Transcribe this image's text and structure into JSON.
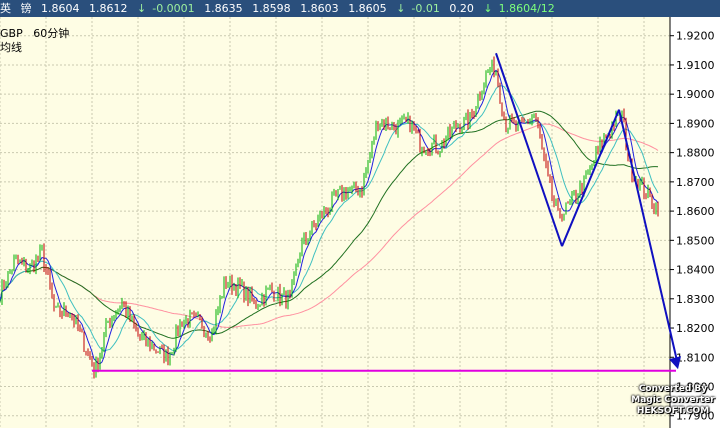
{
  "header": {
    "symbol_cn": "英",
    "symbol_cn2": "镑",
    "values": [
      "1.8604",
      "1.8612"
    ],
    "change_arrow": "↓",
    "change": "-0.0001",
    "ohlc": [
      "1.8635",
      "1.8598",
      "1.8603",
      "1.8605"
    ],
    "pct_arrow": "↓",
    "pct": "-0.01",
    "vol": "0.20",
    "last_arrow": "↓",
    "last": "1.8604/12"
  },
  "info": {
    "symbol": "GBP",
    "period": "60分钟",
    "indicator": "均线"
  },
  "watermark": {
    "line1": "Converted By",
    "line2": "Magic Converter",
    "line3": "HEKSOFT.COM"
  },
  "colors": {
    "background": "#fefde4",
    "grid": "#c9c9b0",
    "candle_up": "#00b000",
    "candle_down": "#c00000",
    "trendline": "#1010c0",
    "support": "#e000e0",
    "ma_dark": "#207020",
    "ma_light": "#ff90a0",
    "ma_fast": "#2020e0",
    "ma_cyan": "#40c0c0"
  },
  "chart_data": {
    "type": "candlestick",
    "ylim": [
      1.7858,
      1.9264
    ],
    "y_ticks": [
      "1.9200",
      "1.9100",
      "1.9000",
      "1.8900",
      "1.8800",
      "1.8700",
      "1.8600",
      "1.8500",
      "1.8400",
      "1.8300",
      "1.8200",
      "1.8100",
      "1.8000",
      "1.7900"
    ],
    "price_path": [
      [
        0,
        1.832
      ],
      [
        15,
        1.843
      ],
      [
        30,
        1.84
      ],
      [
        42,
        1.846
      ],
      [
        55,
        1.825
      ],
      [
        70,
        1.826
      ],
      [
        85,
        1.814
      ],
      [
        95,
        1.805
      ],
      [
        108,
        1.822
      ],
      [
        122,
        1.829
      ],
      [
        138,
        1.817
      ],
      [
        152,
        1.814
      ],
      [
        168,
        1.81
      ],
      [
        182,
        1.823
      ],
      [
        200,
        1.822
      ],
      [
        212,
        1.818
      ],
      [
        225,
        1.836
      ],
      [
        240,
        1.834
      ],
      [
        255,
        1.828
      ],
      [
        270,
        1.833
      ],
      [
        290,
        1.829
      ],
      [
        300,
        1.847
      ],
      [
        320,
        1.858
      ],
      [
        340,
        1.866
      ],
      [
        362,
        1.868
      ],
      [
        378,
        1.891
      ],
      [
        395,
        1.889
      ],
      [
        410,
        1.89
      ],
      [
        420,
        1.883
      ],
      [
        440,
        1.882
      ],
      [
        455,
        1.889
      ],
      [
        470,
        1.891
      ],
      [
        485,
        1.906
      ],
      [
        495,
        1.91
      ],
      [
        505,
        1.89
      ],
      [
        520,
        1.888
      ],
      [
        535,
        1.893
      ],
      [
        548,
        1.87
      ],
      [
        558,
        1.858
      ],
      [
        570,
        1.862
      ],
      [
        585,
        1.87
      ],
      [
        600,
        1.882
      ],
      [
        615,
        1.891
      ],
      [
        622,
        1.893
      ],
      [
        630,
        1.875
      ],
      [
        642,
        1.868
      ],
      [
        655,
        1.862
      ]
    ],
    "trendline": [
      [
        1.843,
        1.914
      ],
      [
        1.914,
        1.848
      ],
      [
        1.848,
        1.8947
      ],
      [
        1.8947,
        1.8073
      ]
    ],
    "support_level": 1.8054
  }
}
